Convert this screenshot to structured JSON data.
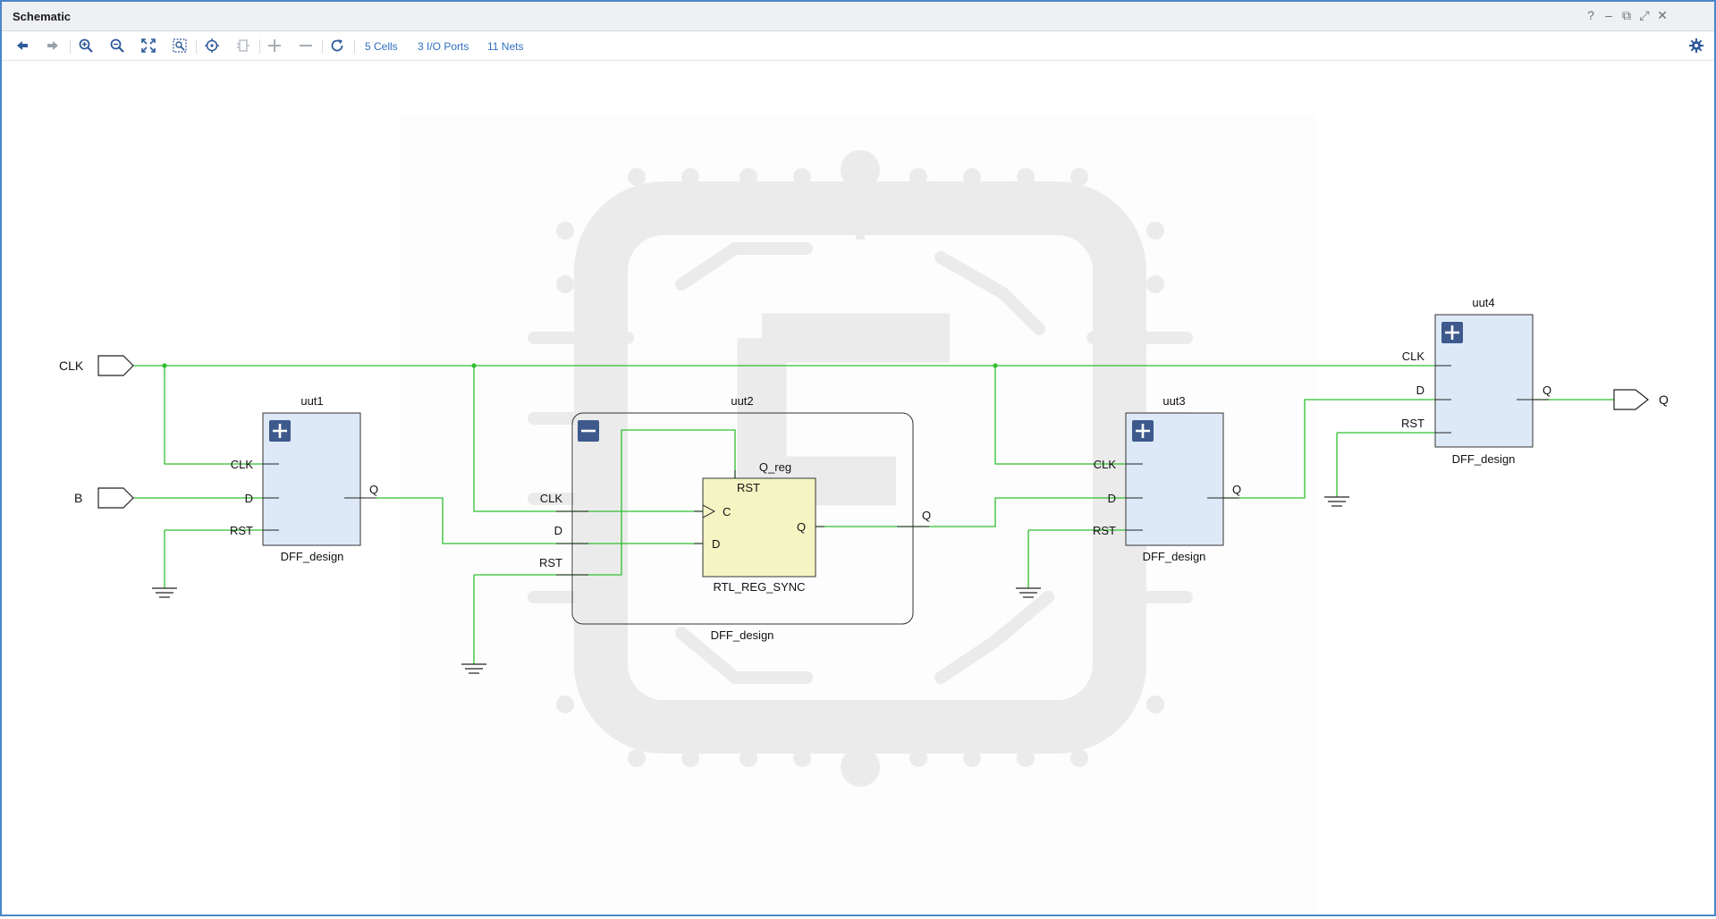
{
  "window": {
    "title": "Schematic"
  },
  "window_controls": [
    "?",
    "–",
    "⧉",
    "⤢",
    "✕"
  ],
  "toolbar": {
    "buttons": [
      "back",
      "forward",
      "zoom-in",
      "zoom-out",
      "fit",
      "zoom-area",
      "select",
      "expand",
      "add",
      "remove",
      "refresh"
    ],
    "cells": "5 Cells",
    "io_ports": "3 I/O Ports",
    "nets": "11 Nets"
  },
  "schematic": {
    "ports": {
      "clk": "CLK",
      "b": "B",
      "q": "Q"
    },
    "cells": {
      "uut1": {
        "name": "uut1",
        "type": "DFF_design",
        "pins": {
          "clk": "CLK",
          "d": "D",
          "rst": "RST",
          "q": "Q"
        }
      },
      "uut2": {
        "name": "uut2",
        "type": "DFF_design",
        "pins": {
          "clk": "CLK",
          "d": "D",
          "rst": "RST",
          "q": "Q"
        }
      },
      "q_reg": {
        "name": "Q_reg",
        "type": "RTL_REG_SYNC",
        "pins": {
          "rst": "RST",
          "c": "C",
          "d": "D",
          "q": "Q"
        }
      },
      "uut3": {
        "name": "uut3",
        "type": "DFF_design",
        "pins": {
          "clk": "CLK",
          "d": "D",
          "rst": "RST",
          "q": "Q"
        }
      },
      "uut4": {
        "name": "uut4",
        "type": "DFF_design",
        "pins": {
          "clk": "CLK",
          "d": "D",
          "rst": "RST",
          "q": "Q"
        }
      }
    }
  },
  "colors": {
    "net": "#2fbf2f",
    "cell_fill": "#dde9f7",
    "reg_fill": "#f4f5c2",
    "expand_btn": "#3e5a8c",
    "window_border": "#4a86c8",
    "link": "#2f6fc1"
  }
}
